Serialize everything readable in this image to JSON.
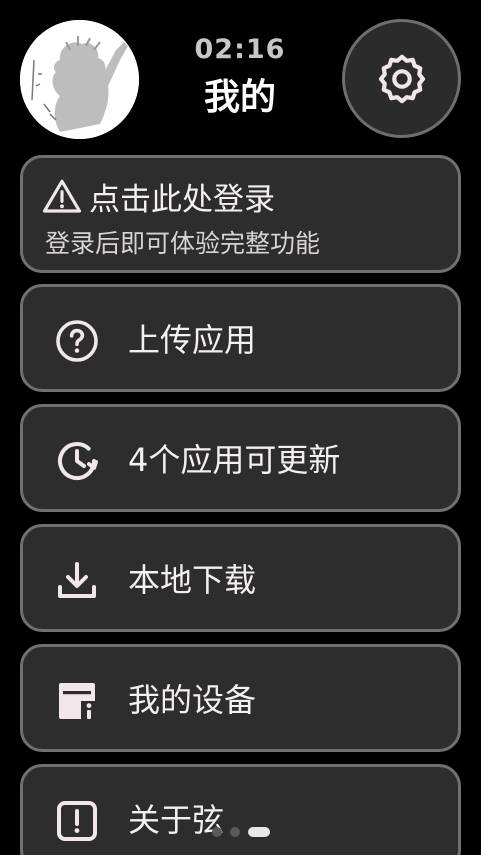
{
  "header": {
    "time": "02:16",
    "title": "我的"
  },
  "login": {
    "title": "点击此处登录",
    "subtitle": "登录后即可体验完整功能",
    "icon": "warning-triangle-icon"
  },
  "menu": [
    {
      "label": "上传应用",
      "icon": "question-circle-icon"
    },
    {
      "label": "4个应用可更新",
      "icon": "clock-update-icon"
    },
    {
      "label": "本地下载",
      "icon": "download-icon"
    },
    {
      "label": "我的设备",
      "icon": "device-info-icon"
    },
    {
      "label": "关于弦",
      "icon": "exclamation-box-icon"
    }
  ],
  "colors": {
    "background": "#000000",
    "card": "#2d2d2d",
    "card_border": "#707070",
    "icon": "#f2e6ea",
    "text": "#f5eff1"
  }
}
